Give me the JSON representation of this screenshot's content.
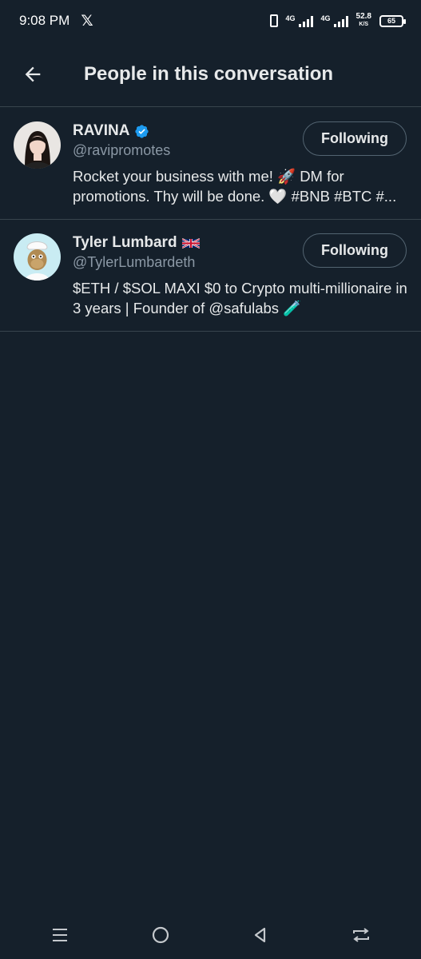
{
  "status_bar": {
    "time": "9:08 PM",
    "app_icon": "x-logo",
    "network_1": "4G",
    "network_2": "4G",
    "speed_value": "52.8",
    "speed_unit": "K/S",
    "battery": "65"
  },
  "header": {
    "back_icon": "arrow-left-icon",
    "title": "People in this conversation"
  },
  "people": [
    {
      "name": "RAVINA",
      "badge": "verified-badge-icon",
      "handle": "@ravipromotes",
      "bio": "Rocket your business with me! 🚀 DM for promotions. Thy will be done. 🤍 #BNB #BTC #...",
      "follow_label": "Following"
    },
    {
      "name": "Tyler Lumbard",
      "badge": "uk-flag-icon",
      "handle": "@TylerLumbardeth",
      "bio": "$ETH / $SOL MAXI $0 to Crypto multi-millionaire in 3 years | Founder of @safulabs 🧪",
      "follow_label": "Following"
    }
  ],
  "nav_bar": {
    "buttons": [
      "menu-icon",
      "home-circle-icon",
      "back-triangle-icon",
      "switch-apps-icon"
    ]
  },
  "colors": {
    "background": "#15202b",
    "divider": "#38444d",
    "verified": "#1d9bf0",
    "secondary_text": "#8b98a5"
  }
}
